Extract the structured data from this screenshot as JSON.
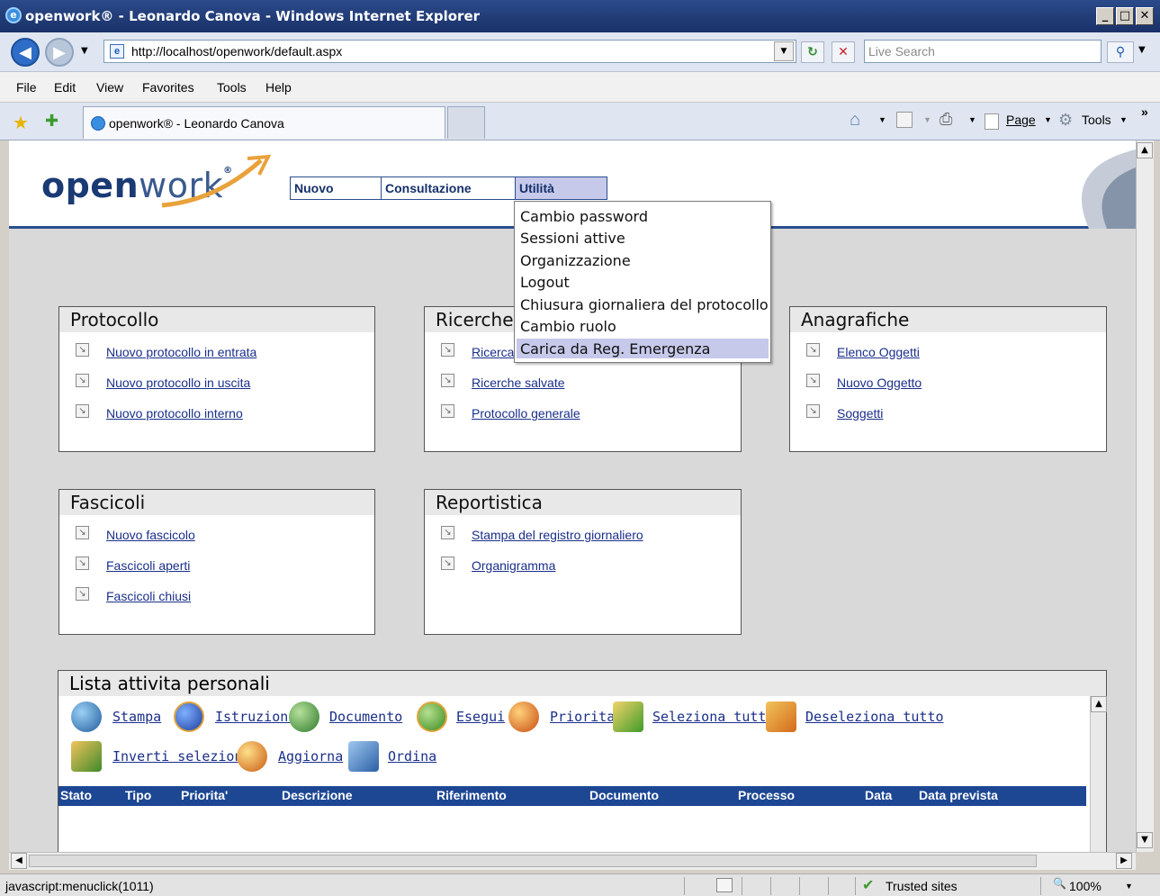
{
  "window": {
    "title": "openwork® - Leonardo Canova - Windows Internet Explorer"
  },
  "address": {
    "url": "http://localhost/openwork/default.aspx",
    "search_placeholder": "Live Search"
  },
  "menubar": [
    "File",
    "Edit",
    "View",
    "Favorites",
    "Tools",
    "Help"
  ],
  "tab": {
    "title": "openwork® - Leonardo Canova"
  },
  "commandbar": {
    "page": "Page",
    "tools": "Tools"
  },
  "app": {
    "logo_bold": "open",
    "logo_rest": "work",
    "logo_mark": "®",
    "topmenu": [
      "Nuovo",
      "Consultazione",
      "Utilità"
    ],
    "dropdown": [
      "Cambio password",
      "Sessioni attive",
      "Organizzazione",
      "Logout",
      "Chiusura giornaliera del protocollo",
      "Cambio ruolo",
      "Carica da Reg. Emergenza"
    ],
    "panels": {
      "protocollo": {
        "title": "Protocollo",
        "items": [
          "Nuovo protocollo in entrata",
          "Nuovo protocollo in uscita",
          "Nuovo protocollo interno"
        ]
      },
      "ricerche": {
        "title": "Ricerche",
        "items": [
          "Ricerca",
          "Ricerche salvate",
          "Protocollo generale"
        ]
      },
      "anagrafiche": {
        "title": "Anagrafiche",
        "items": [
          "Elenco Oggetti",
          "Nuovo Oggetto",
          "Soggetti"
        ]
      },
      "fascicoli": {
        "title": "Fascicoli",
        "items": [
          "Nuovo fascicolo",
          "Fascicoli aperti",
          "Fascicoli chiusi"
        ]
      },
      "reportistica": {
        "title": "Reportistica",
        "items": [
          "Stampa del registro giornaliero",
          "Organigramma"
        ]
      }
    },
    "attivita": {
      "title": "Lista attivita personali",
      "actions": [
        "Stampa",
        "Istruzioni",
        "Documento",
        "Esegui",
        "Priorita'",
        "Seleziona tutto",
        "Deseleziona tutto",
        "Inverti selezione",
        "Aggiorna",
        "Ordina"
      ],
      "columns": [
        "Stato",
        "Tipo",
        "Priorita'",
        "Descrizione",
        "Riferimento",
        "Documento",
        "Processo",
        "Data",
        "Data prevista"
      ]
    }
  },
  "status": {
    "text": "javascript:menuclick(1011)",
    "zone": "Trusted sites",
    "zoom": "100%"
  },
  "colors": {
    "title_bar": "#1a3168",
    "accent": "#2b4e8f",
    "menu_highlight": "#c6c9ea",
    "grid_header": "#1d4793",
    "link": "#1a2f8a"
  }
}
